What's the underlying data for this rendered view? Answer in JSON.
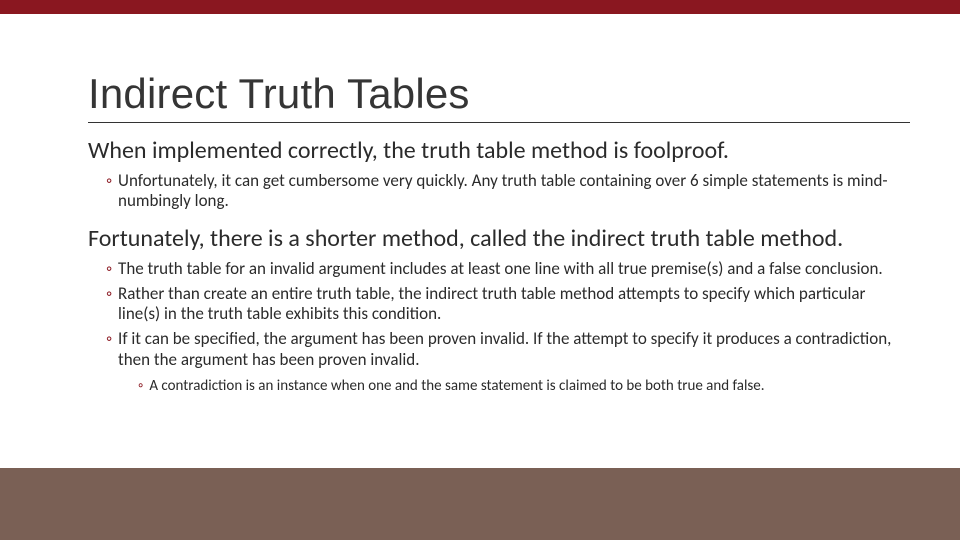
{
  "slide": {
    "title": "Indirect Truth Tables",
    "p1": "When implemented correctly, the truth table method is foolproof.",
    "p1_sub": "Unfortunately, it can get cumbersome very quickly. Any truth table containing over 6 simple statements is mind-numbingly long.",
    "p2": "Fortunately, there is a shorter method, called the indirect truth table method.",
    "p2_subs": [
      "The truth table for an invalid argument includes at least one line with all true premise(s) and a false conclusion.",
      "Rather than create an entire truth table, the indirect truth table method attempts to specify which particular line(s) in the truth table exhibits this condition.",
      "If it can be specified, the argument has been proven invalid. If the attempt to specify it produces a contradiction, then the argument has been proven invalid."
    ],
    "p2_subsub": "A contradiction is an instance when one and the same statement is claimed to be both true and false."
  },
  "colors": {
    "accent": "#8a1720",
    "footer": "#7a6055"
  }
}
